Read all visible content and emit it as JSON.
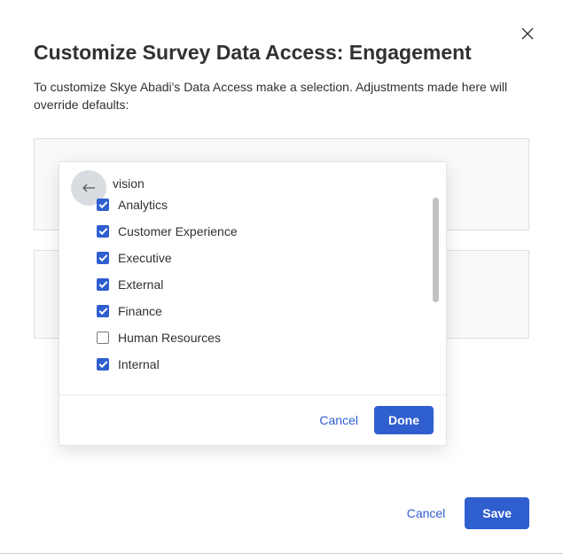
{
  "modal": {
    "title": "Customize Survey Data Access: Engagement",
    "description": "To customize Skye Abadi's Data Access make a selection. Adjustments made here will override defaults:",
    "cancel_label": "Cancel",
    "save_label": "Save"
  },
  "popover": {
    "header_text": "vision",
    "cancel_label": "Cancel",
    "done_label": "Done",
    "items": [
      {
        "label": "Analytics",
        "checked": true
      },
      {
        "label": "Customer Experience",
        "checked": true
      },
      {
        "label": "Executive",
        "checked": true
      },
      {
        "label": "External",
        "checked": true
      },
      {
        "label": "Finance",
        "checked": true
      },
      {
        "label": "Human Resources",
        "checked": false
      },
      {
        "label": "Internal",
        "checked": true
      }
    ]
  },
  "colors": {
    "primary": "#2f5ecf",
    "text": "#323130",
    "border": "#e1dfdd",
    "panel_bg": "#faf9f8"
  }
}
